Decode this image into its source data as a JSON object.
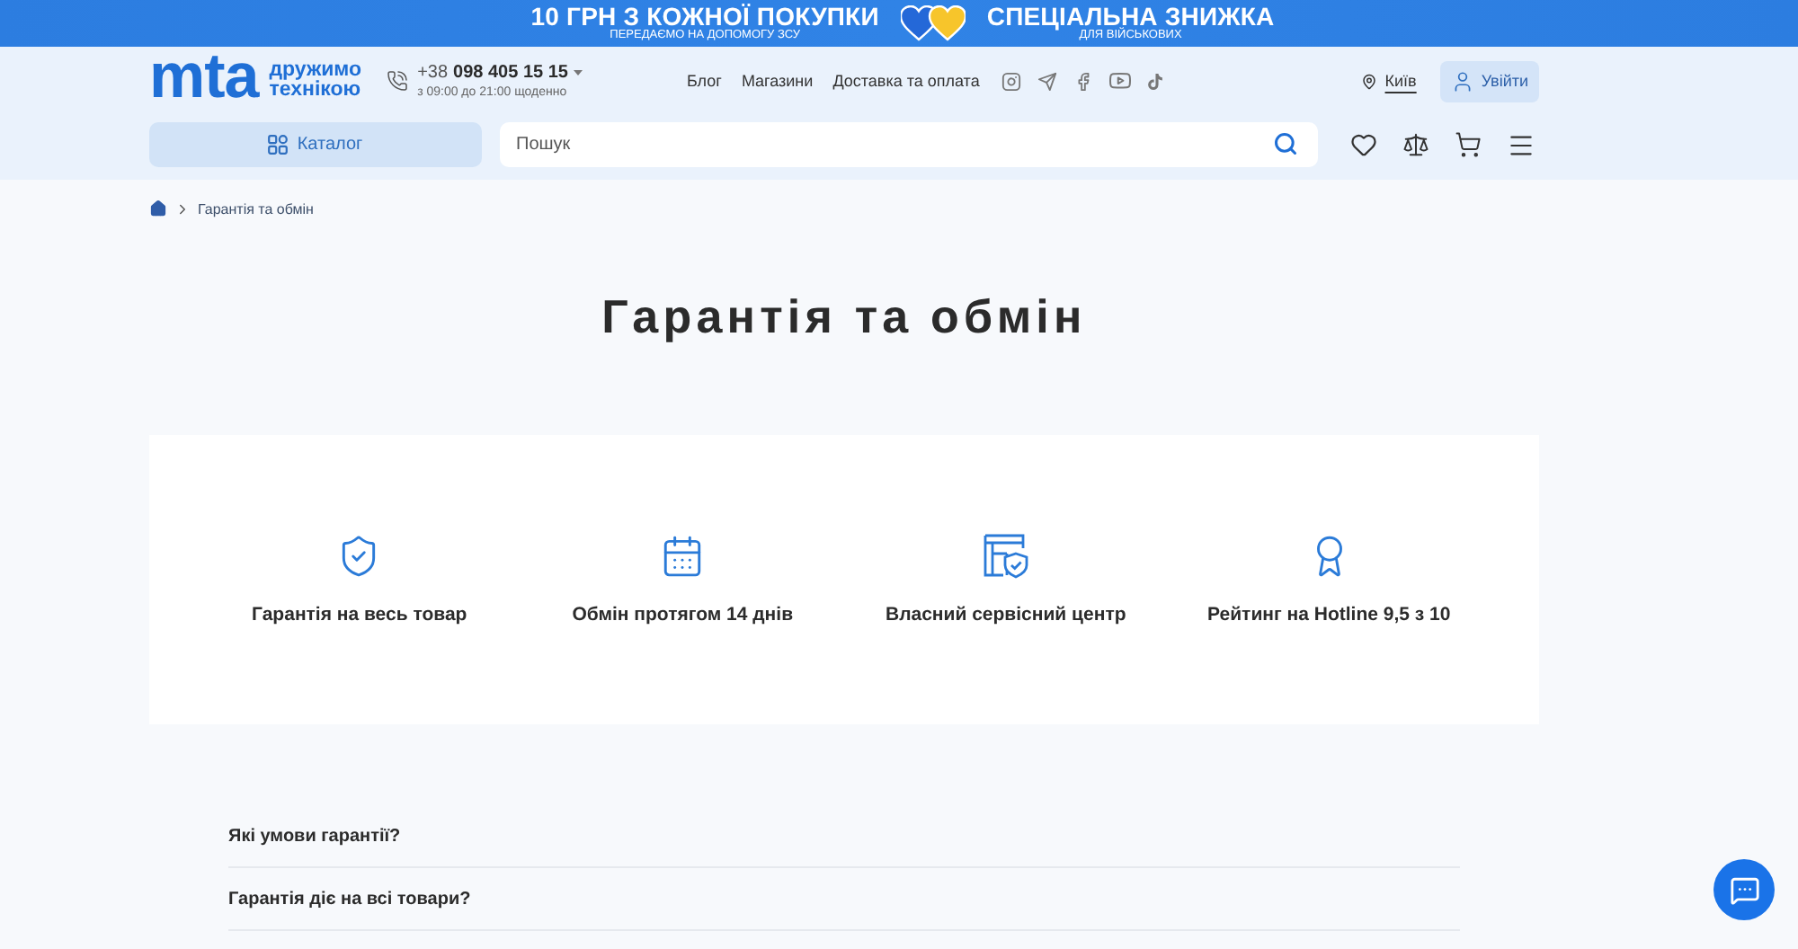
{
  "promo_banner": {
    "left": {
      "title": "10 ГРН З КОЖНОЇ ПОКУПКИ",
      "subtitle": "ПЕРЕДАЄМО НА ДОПОМОГУ ЗСУ"
    },
    "right": {
      "title": "СПЕЦІАЛЬНА ЗНИЖКА",
      "subtitle": "ДЛЯ ВІЙСЬКОВИХ"
    }
  },
  "header": {
    "logo": {
      "mark": "mta",
      "tagline": [
        "дружимо",
        "технікою"
      ]
    },
    "phone": {
      "code": "+38",
      "number": "098 405 15 15",
      "hours": "з 09:00 до 21:00 щоденно"
    },
    "nav": [
      "Блог",
      "Магазини",
      "Доставка та оплата"
    ],
    "city": "Київ",
    "login_button": "Увійти",
    "catalog_button": "Каталог",
    "search": {
      "placeholder": "Пошук"
    }
  },
  "breadcrumb": [
    "Гарантія та обмін"
  ],
  "page_title": "Гарантія та обмін",
  "features": [
    {
      "label": "Гарантія на весь товар"
    },
    {
      "label": "Обмін протягом 14 днів"
    },
    {
      "label": "Власний сервісний центр"
    },
    {
      "label": "Рейтинг на Hotline 9,5 з 10"
    }
  ],
  "faq": [
    {
      "question": "Які умови гарантії?"
    },
    {
      "question": "Гарантія діє на всі товари?"
    }
  ]
}
